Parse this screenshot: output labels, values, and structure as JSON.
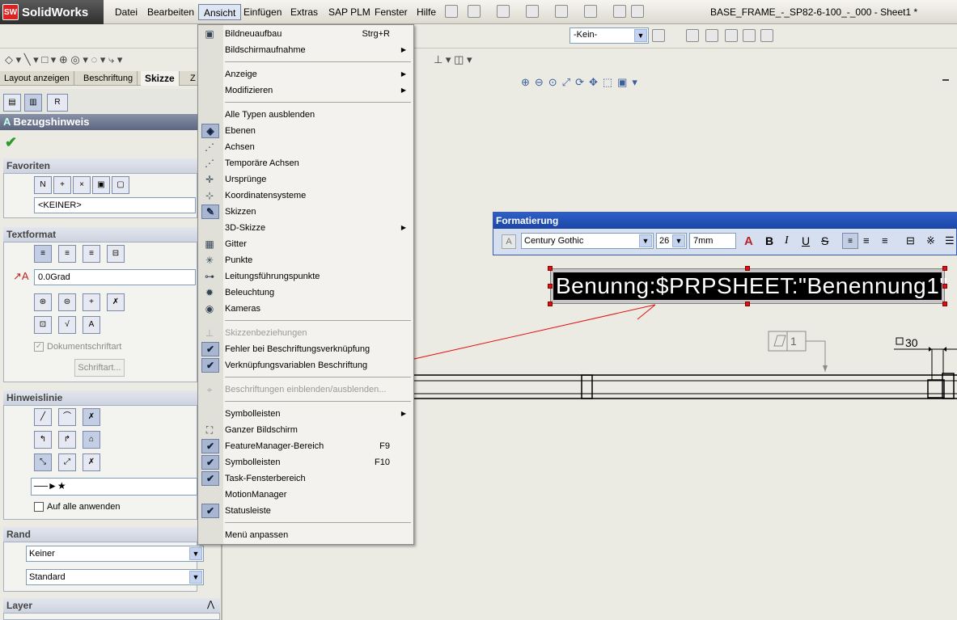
{
  "app": {
    "logo_text": "SolidWorks",
    "doc_title": "BASE_FRAME_-_SP82-6-100_-_000 - Sheet1 *"
  },
  "menubar": [
    "Datei",
    "Bearbeiten",
    "Ansicht",
    "Einfügen",
    "Extras",
    "SAP PLM",
    "Fenster",
    "Hilfe"
  ],
  "toolbar": {
    "layer_select": "-Kein-"
  },
  "tabs": [
    "Layout anzeigen",
    "Beschriftung",
    "Skizze",
    "Z"
  ],
  "panel": {
    "title": "Bezugshinweis",
    "favoriten": {
      "heading": "Favoriten",
      "value": "<KEINER>"
    },
    "textformat": {
      "heading": "Textformat",
      "angle": "0.0Grad",
      "doc_font_label": "Dokumentschriftart",
      "font_button": "Schriftart..."
    },
    "hinweislinie": {
      "heading": "Hinweislinie",
      "apply_all": "Auf alle anwenden"
    },
    "rand": {
      "heading": "Rand",
      "style": "Keiner",
      "size": "Standard"
    },
    "layer": {
      "heading": "Layer"
    }
  },
  "dropdown": {
    "items": [
      {
        "label": "Bildneuaufbau",
        "shortcut": "Strg+R",
        "icon": "monitor-icon"
      },
      {
        "label": "Bildschirmaufnahme",
        "submenu": true
      },
      {
        "label": "Anzeige",
        "submenu": true
      },
      {
        "label": "Modifizieren",
        "submenu": true
      },
      {
        "label": "Alle Typen ausblenden"
      },
      {
        "label": "Ebenen",
        "icon": "planes-icon",
        "checked": true
      },
      {
        "label": "Achsen",
        "icon": "axes-icon"
      },
      {
        "label": "Temporäre Achsen",
        "icon": "temp-axes-icon"
      },
      {
        "label": "Ursprünge",
        "icon": "origins-icon"
      },
      {
        "label": "Koordinatensysteme",
        "icon": "coordinate-system-icon"
      },
      {
        "label": "Skizzen",
        "icon": "sketch-icon",
        "checked": true
      },
      {
        "label": "3D-Skizze",
        "submenu": true
      },
      {
        "label": "Gitter",
        "icon": "grid-icon"
      },
      {
        "label": "Punkte",
        "icon": "points-icon"
      },
      {
        "label": "Leitungsführungspunkte",
        "icon": "routing-points-icon"
      },
      {
        "label": "Beleuchtung",
        "icon": "bulb-icon"
      },
      {
        "label": "Kameras",
        "icon": "camera-icon"
      },
      {
        "label": "Skizzenbeziehungen",
        "icon": "sketch-relations-icon",
        "disabled": true
      },
      {
        "label": "Fehler bei Beschriftungsverknüpfung",
        "checked": true
      },
      {
        "label": "Verknüpfungsvariablen Beschriftung",
        "checked": true
      },
      {
        "label": "Beschriftungen einblenden/ausblenden...",
        "icon": "annotation-icon",
        "disabled": true
      },
      {
        "label": "Symbolleisten",
        "submenu": true
      },
      {
        "label": "Ganzer Bildschirm",
        "icon": "fullscreen-icon"
      },
      {
        "label": "FeatureManager-Bereich",
        "shortcut": "F9",
        "checked": true
      },
      {
        "label": "Symbolleisten",
        "shortcut": "F10",
        "checked": true
      },
      {
        "label": "Task-Fensterbereich",
        "checked": true
      },
      {
        "label": "MotionManager"
      },
      {
        "label": "Statusleiste",
        "checked": true
      },
      {
        "label": "Menü anpassen"
      }
    ]
  },
  "formatting": {
    "title": "Formatierung",
    "font": "Century Gothic",
    "size": "26",
    "height": "7mm",
    "buttons": [
      "A",
      "B",
      "I",
      "U",
      "S"
    ]
  },
  "note": {
    "text": "Benunng:$PRPSHEET:\"Benennung1\""
  },
  "drawing": {
    "balloon_number": "1",
    "dimension": "30"
  },
  "colors": {
    "menu_hilite": "#dfe6f3",
    "title_blue": "#2c5fc8",
    "annotation_red": "#e01010"
  }
}
